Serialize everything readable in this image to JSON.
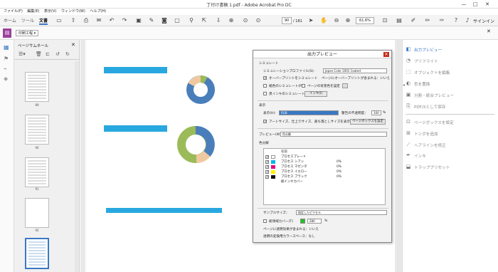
{
  "window": {
    "title": "丁付け書稿 1.pdf - Adobe Acrobat Pro DC",
    "min": "—",
    "max": "□",
    "close": "✕"
  },
  "menu": [
    "ファイル(F)",
    "編集(E)",
    "表示(V)",
    "ウィンドウ(W)",
    "ヘルプ(H)"
  ],
  "tabs": {
    "home": "ホーム",
    "tools": "ツール",
    "document": "文書"
  },
  "toolbar": {
    "page_current": "90",
    "page_total": "/ 181",
    "zoom": "61.6%",
    "signin": "サインイン"
  },
  "secondary": {
    "label": "印刷工程"
  },
  "thumbs": {
    "title": "ページサムネール",
    "labels": [
      "89",
      "90",
      "91",
      "92",
      ""
    ]
  },
  "preview_dialog": {
    "title": "出力プレビュー",
    "close": "✕",
    "simulate_header": "シミュレート",
    "sim_profile_label": "シミュレーションプロファイル(S):",
    "sim_profile_value": "Japan Color 2001 Coated",
    "overprint_label": "オーバープリントをシミュレート",
    "overprint_note": "ページにオーバープリントが含まれる：いいえ",
    "paper_color_label": "紙色のシミュレート(P)",
    "page_bg_label": "ページの背景色を設定",
    "black_ink_label": "黒インキのシミュレート(B)",
    "ink_button": "インキ(I)",
    "display_header": "表示",
    "display_label": "表示(H):",
    "display_value": "RGB",
    "warn_label": "警告の不透明度：",
    "warn_value": "100",
    "warn_unit": "%",
    "artsize_label": "アートサイズ、仕上りサイズ、裁ち落としサイズを表示(A)",
    "pagebox_button": "ページボックスを設定",
    "preview_label": "プレビュー(W):",
    "preview_value": "色分解",
    "separations_header": "色分解",
    "col_name": "名前",
    "separations": [
      {
        "name": "プロセスプレート",
        "pct": "",
        "color": "#ffffff"
      },
      {
        "name": "プロセス シアン",
        "pct": "0%",
        "color": "#00b4ee"
      },
      {
        "name": "プロセス マゼンタ",
        "pct": "0%",
        "color": "#e4007f"
      },
      {
        "name": "プロセス イエロー",
        "pct": "0%",
        "color": "#fff000"
      },
      {
        "name": "プロセス ブラック",
        "pct": "0%",
        "color": "#111111"
      },
      {
        "name": "総インキカバー",
        "pct": "",
        "color": ""
      }
    ],
    "sample_label": "サンプルサイズ：",
    "sample_value": "指定したピクセル",
    "total_coverage_label": "総領域カバー(T)",
    "total_coverage_value": "280",
    "transparency_label": "ページに透明効果が含まれる：いいえ",
    "blend_label": "透明の変換用カラースペース：なし"
  },
  "right_panel": {
    "items": [
      {
        "label": "出力プレビュー",
        "icon": "output-preview-icon",
        "active": true
      },
      {
        "label": "プリフライト",
        "icon": "preflight-icon",
        "active": false
      },
      {
        "label": "オブジェクトを編集",
        "icon": "edit-object-icon",
        "active": false
      },
      {
        "label": "色を置換",
        "icon": "convert-color-icon",
        "active": false
      },
      {
        "label": "分割・統合プレビュー",
        "icon": "flatten-preview-icon",
        "active": false
      },
      {
        "label": "PDF/Xとして保存",
        "icon": "save-pdfx-icon",
        "active": false
      },
      {
        "label": "ページボックスを設定",
        "icon": "page-box-icon",
        "active": false
      },
      {
        "label": "トンボを追加",
        "icon": "trim-marks-icon",
        "active": false
      },
      {
        "label": "ヘアラインを修正",
        "icon": "hairline-icon",
        "active": false
      },
      {
        "label": "インキ",
        "icon": "ink-icon",
        "active": false
      },
      {
        "label": "トラッププリセット",
        "icon": "trap-preset-icon",
        "active": false
      }
    ]
  },
  "colors": {
    "blue": "#3a78c3",
    "pie_blue": "#4a7ebb",
    "pie_green": "#9bbb59",
    "pie_orange": "#f0c8a0",
    "bar": "#29a8e0"
  }
}
